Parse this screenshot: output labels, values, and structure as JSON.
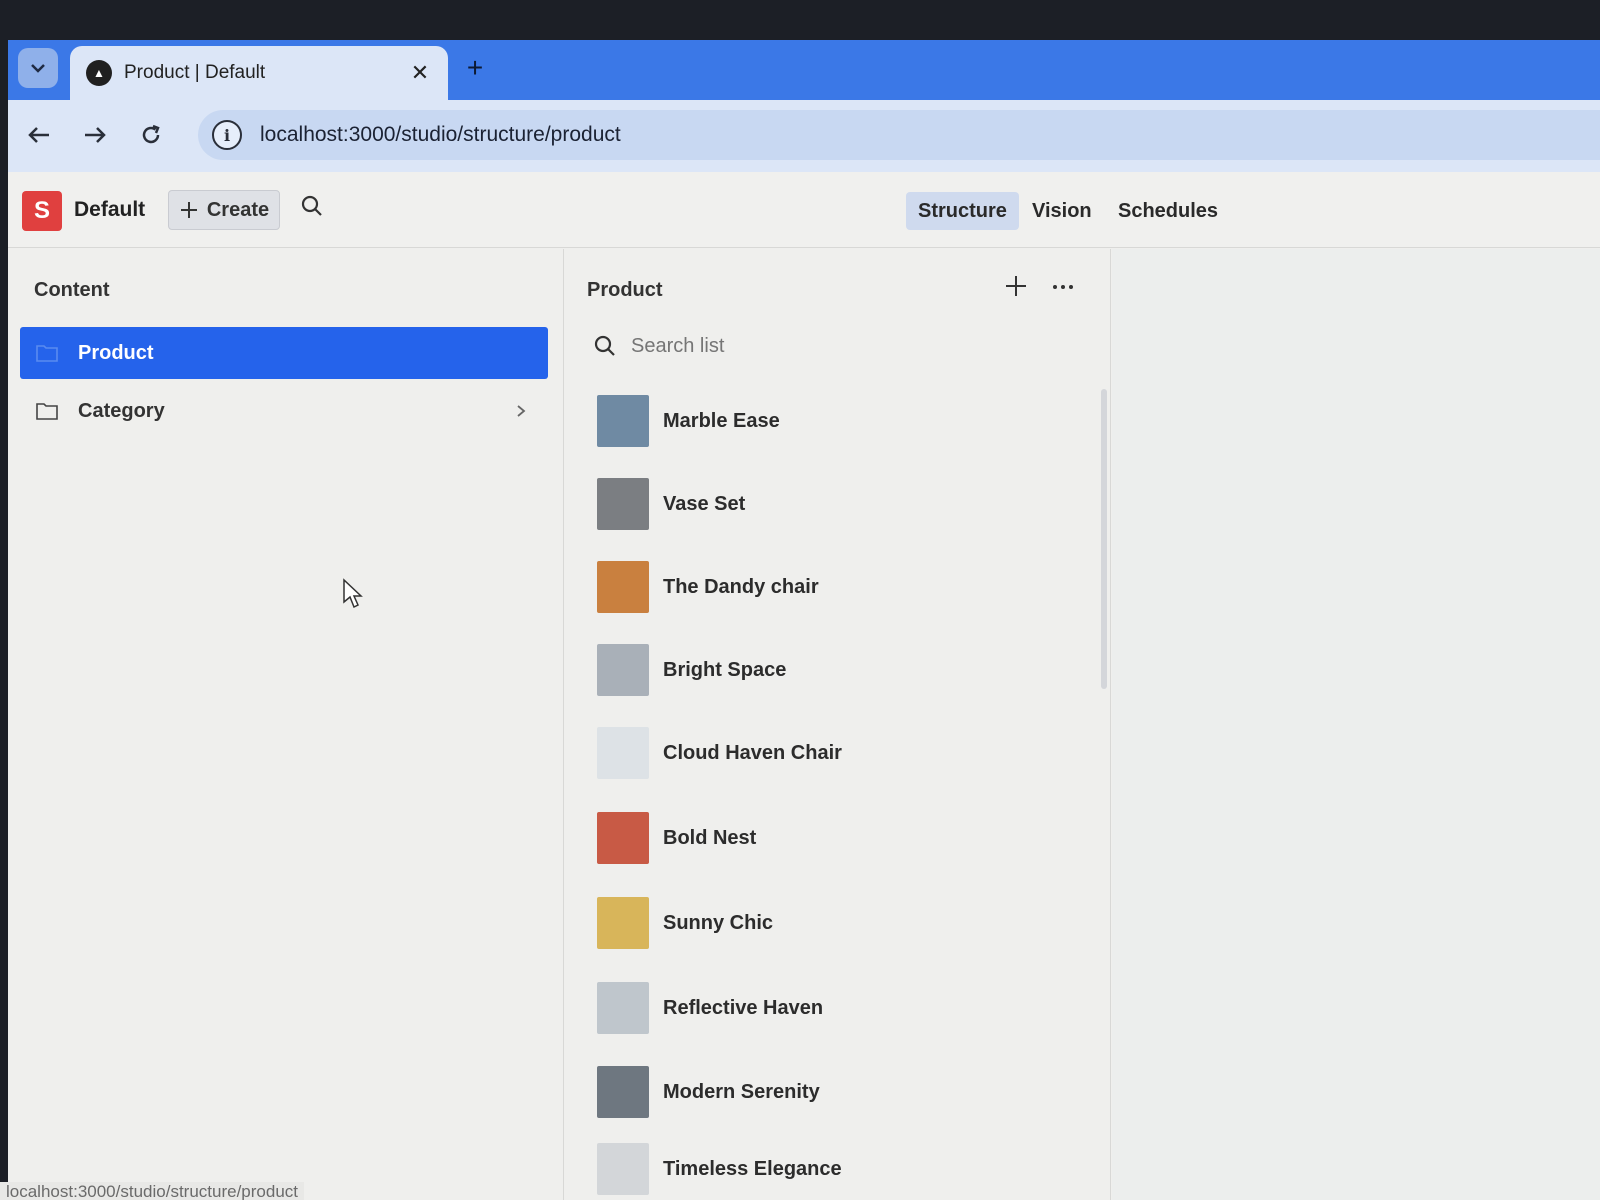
{
  "browser": {
    "tab_title": "Product | Default",
    "tab_close": "✕",
    "new_tab": "+",
    "url": "localhost:3000/studio/structure/product",
    "status_url": "localhost:3000/studio/structure/product"
  },
  "studio": {
    "logo_letter": "S",
    "workspace": "Default",
    "create_label": "Create",
    "nav_tabs": [
      {
        "label": "Structure",
        "active": true
      },
      {
        "label": "Vision",
        "active": false
      },
      {
        "label": "Schedules",
        "active": false
      }
    ]
  },
  "content_pane": {
    "title": "Content",
    "items": [
      {
        "label": "Product",
        "selected": true
      },
      {
        "label": "Category",
        "selected": false
      }
    ]
  },
  "product_pane": {
    "title": "Product",
    "search_placeholder": "Search list",
    "items": [
      {
        "title": "Marble Ease",
        "thumb_color": "#6f8aa3"
      },
      {
        "title": "Vase Set",
        "thumb_color": "#7b7e82"
      },
      {
        "title": "The Dandy chair",
        "thumb_color": "#c9803f"
      },
      {
        "title": "Bright Space",
        "thumb_color": "#a9b0b8"
      },
      {
        "title": "Cloud Haven Chair",
        "thumb_color": "#dde2e6"
      },
      {
        "title": "Bold Nest",
        "thumb_color": "#c85a45"
      },
      {
        "title": "Sunny Chic",
        "thumb_color": "#d8b55a"
      },
      {
        "title": "Reflective Haven",
        "thumb_color": "#bfc6cc"
      },
      {
        "title": "Modern Serenity",
        "thumb_color": "#6e7780"
      },
      {
        "title": "Timeless Elegance",
        "thumb_color": "#d3d6d9"
      }
    ]
  }
}
